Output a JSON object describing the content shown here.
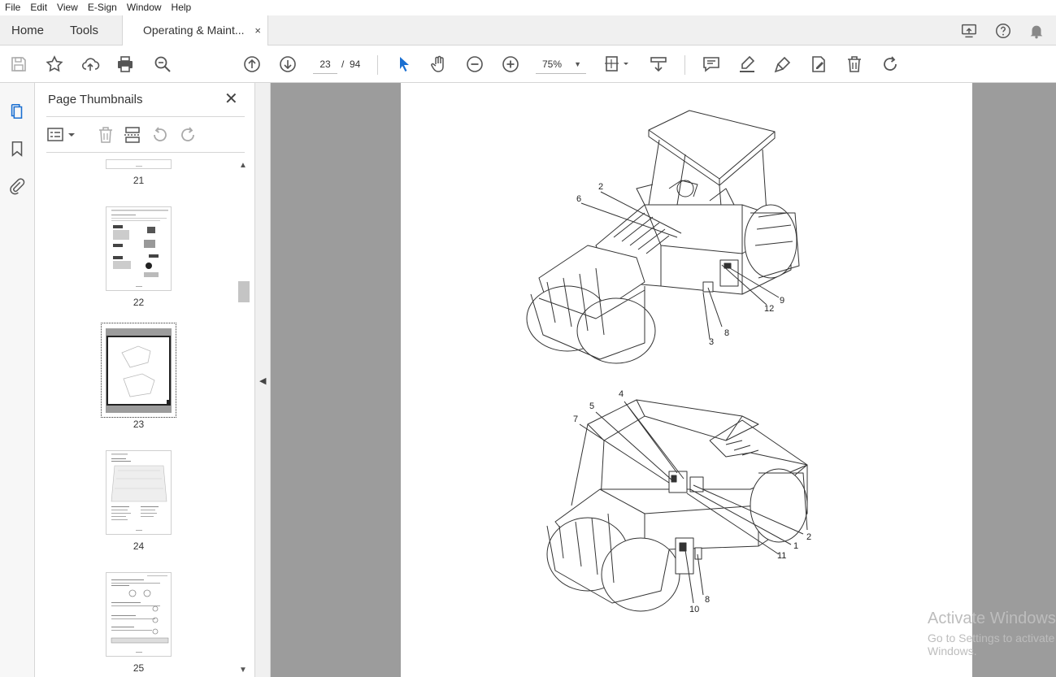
{
  "menu": [
    "File",
    "Edit",
    "View",
    "E-Sign",
    "Window",
    "Help"
  ],
  "tabs": {
    "home": "Home",
    "tools": "Tools",
    "document": "Operating & Maint...",
    "close_glyph": "×"
  },
  "toolbar": {
    "current_page": "23",
    "page_separator": "/",
    "total_pages": "94",
    "zoom": "75%"
  },
  "thumbnails": {
    "title": "Page Thumbnails",
    "close_glyph": "✕",
    "pages": [
      "21",
      "22",
      "23",
      "24",
      "25"
    ],
    "selected_page": "23"
  },
  "diagram": {
    "top_labels": [
      "2",
      "6",
      "9",
      "12",
      "8",
      "3"
    ],
    "bottom_labels": [
      "4",
      "5",
      "7",
      "2",
      "1",
      "11",
      "8",
      "10"
    ]
  },
  "watermark": {
    "line1": "Activate Windows",
    "line2": "Go to Settings to activate Windows."
  }
}
